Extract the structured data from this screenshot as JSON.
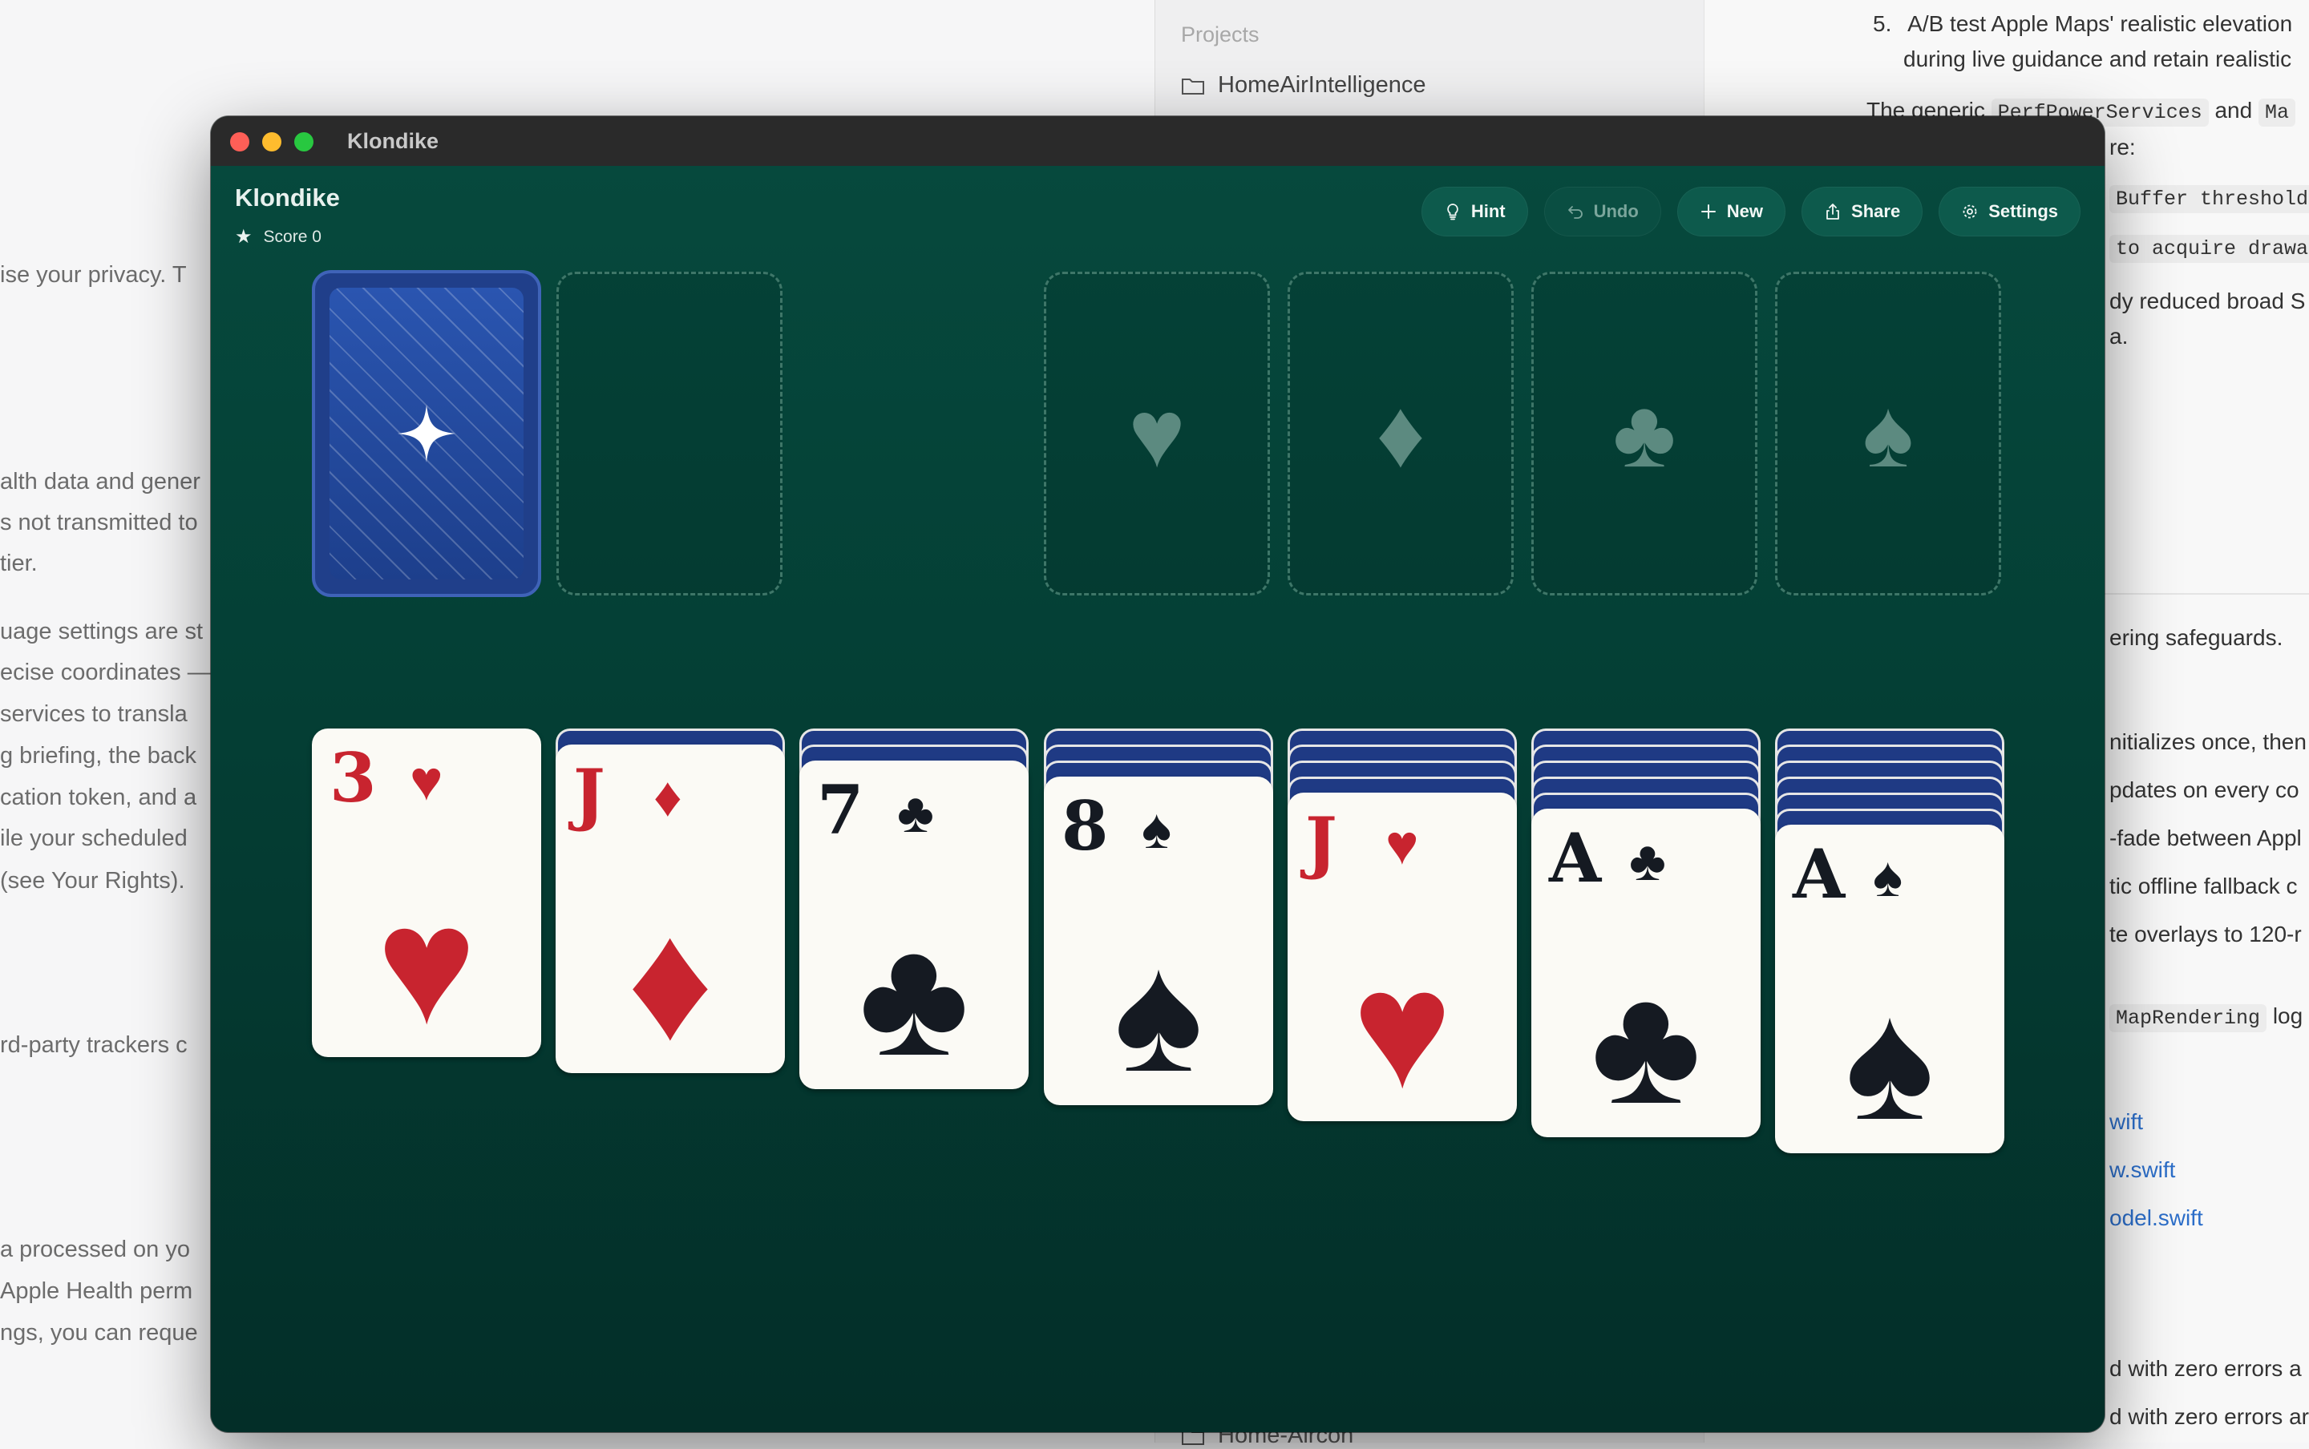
{
  "background": {
    "left_lines": [
      "ise your privacy. T",
      "alth data and gener",
      "s not transmitted to",
      " tier.",
      "uage settings are st",
      "ecise coordinates —",
      " services to transla",
      "g briefing, the back",
      "cation token, and a",
      "ile your scheduled",
      "(see Your Rights).",
      "rd-party trackers c",
      "a processed on yo",
      "Apple Health perm",
      "ngs, you can reque"
    ],
    "sidebar": {
      "section_label": "Projects",
      "items": [
        "HomeAirIntelligence",
        "Home-Aircon"
      ]
    },
    "right_lines": {
      "item5_number": "5.",
      "item5_line1": "A/B test Apple Maps' realistic elevation",
      "item5_line2": "during live guidance and retain realistic",
      "generic_prefix": "The generic",
      "generic_code": "PerfPowerServices",
      "generic_and": "and",
      "generic_code2": "Ma",
      "are_text": "re:",
      "code_buffer": "Buffer threshold",
      "code_acquire": "to acquire drawab",
      "reduced_line1": "dy reduced broad S",
      "reduced_line2": "a.",
      "safeguards": "ering safeguards.",
      "init_once": "nitializes once, then",
      "updates": "pdates on every co",
      "fade": "-fade between Appl",
      "offline": "tic offline fallback c",
      "overlays": "te overlays to 120-r",
      "maprendering_code": "MapRendering",
      "maprendering_tail": "log",
      "link1": "wift",
      "link2": "w.swift",
      "link3": "odel.swift",
      "zero1": "d with zero errors a",
      "zero2": "d with zero errors ar"
    }
  },
  "window": {
    "title": "Klondike",
    "app_title": "Klondike",
    "score_label": "Score 0",
    "toolbar": {
      "hint": "Hint",
      "undo": "Undo",
      "new": "New",
      "share": "Share",
      "settings": "Settings"
    },
    "foundations": [
      "♥",
      "♦",
      "♣",
      "♠"
    ],
    "tableau": [
      {
        "rank": "3",
        "suit": "♥",
        "color": "red",
        "hidden": 0
      },
      {
        "rank": "J",
        "suit": "♦",
        "color": "red",
        "hidden": 1
      },
      {
        "rank": "7",
        "suit": "♣",
        "color": "black",
        "hidden": 2
      },
      {
        "rank": "8",
        "suit": "♠",
        "color": "black",
        "hidden": 3
      },
      {
        "rank": "J",
        "suit": "♥",
        "color": "red",
        "hidden": 4
      },
      {
        "rank": "A",
        "suit": "♣",
        "color": "black",
        "hidden": 5
      },
      {
        "rank": "A",
        "suit": "♠",
        "color": "black",
        "hidden": 6
      }
    ],
    "colors": {
      "felt": "#043e34",
      "card_back": "#1f3a84",
      "red_suit": "#c8242f",
      "black_suit": "#151a22"
    }
  }
}
